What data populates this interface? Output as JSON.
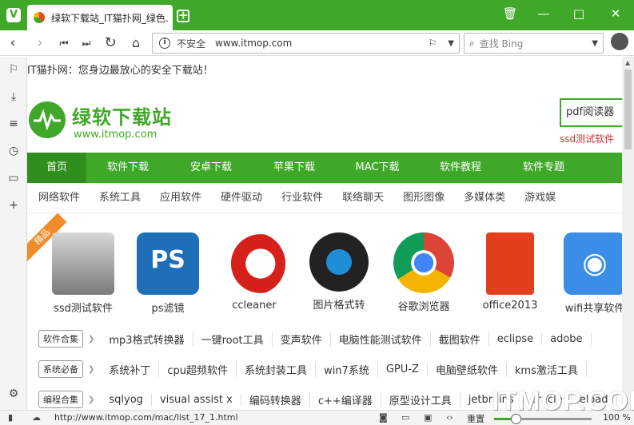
{
  "window": {
    "tab_title": "绿软下载站_IT猫扑网_绿色…",
    "tab_close": "×",
    "new_tab": "+",
    "buttons": {
      "trash": "🗑",
      "minimize": "—",
      "maximize": "□",
      "close": "✕"
    }
  },
  "toolbar": {
    "security_label": "不安全",
    "url": "www.itmop.com",
    "search_placeholder": "查找 Bing"
  },
  "page": {
    "tagline": "IT猫扑网：您身边最放心的安全下载站！",
    "logo_name": "绿软下载站",
    "logo_url": "www.itmop.com",
    "search_value": "pdf阅读器",
    "hot_word": "ssd测试软件",
    "main_nav": [
      "首页",
      "软件下载",
      "安卓下载",
      "苹果下载",
      "MAC下载",
      "软件教程",
      "软件专题"
    ],
    "sub_nav": [
      "网络软件",
      "系统工具",
      "应用软件",
      "硬件驱动",
      "行业软件",
      "联络聊天",
      "图形图像",
      "多媒体类",
      "游戏娱"
    ],
    "ribbon": "精品",
    "apps": [
      {
        "label": "ssd测试软件",
        "icon": "ssd-icon"
      },
      {
        "label": "ps滤镜",
        "icon": "photoshop-icon"
      },
      {
        "label": "ccleaner",
        "icon": "ccleaner-icon"
      },
      {
        "label": "图片格式转",
        "icon": "convert-icon"
      },
      {
        "label": "谷歌浏览器",
        "icon": "chrome-icon"
      },
      {
        "label": "office2013",
        "icon": "office-icon"
      },
      {
        "label": "wifi共享软件",
        "icon": "wifi-icon"
      }
    ],
    "tag_rows": [
      {
        "tag": "软件合集",
        "links": [
          "mp3格式转换器",
          "一键root工具",
          "变声软件",
          "电脑性能测试软件",
          "截图软件",
          "eclipse",
          "adobe"
        ]
      },
      {
        "tag": "系统必备",
        "links": [
          "系统补丁",
          "cpu超频软件",
          "系统封装工具",
          "win7系统",
          "GPU-Z",
          "电脑壁纸软件",
          "kms激活工具"
        ]
      },
      {
        "tag": "编程合集",
        "links": [
          "sqlyog",
          "visual assist x",
          "编码转换器",
          "c++编译器",
          "原型设计工具",
          "jetbrains",
          "oracle",
          "eload"
        ]
      }
    ]
  },
  "status": {
    "url": "http://www.itmop.com/mac/list_17_1.html",
    "reset_label": "重置",
    "zoom": "100 %",
    "zoom_fraction": 0.22
  },
  "watermark": "ITMOP.COM",
  "colors": {
    "brand": "#40a829",
    "nav_active": "#2e8f1c",
    "hot": "#d63030",
    "ribbon": "#f08c2a"
  }
}
